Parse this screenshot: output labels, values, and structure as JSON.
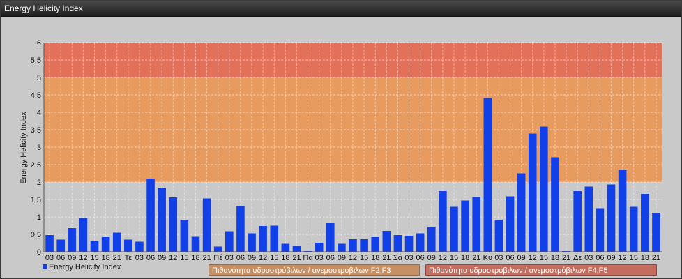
{
  "window": {
    "title": "Energy Helicity Index"
  },
  "legend": {
    "series_label": "Energy Helicity Index"
  },
  "bands": [
    {
      "label": "Πιθανότητα υδροστρόβιλων / ανεμοστρόβιλων F2,F3",
      "range": [
        2,
        5
      ],
      "color": "#e89b5e"
    },
    {
      "label": "Πιθανότητα υδροστρόβιλων / ανεμοστρόβιλων F4,F5",
      "range": [
        5,
        6
      ],
      "color": "#e37058"
    }
  ],
  "chart_data": {
    "type": "bar",
    "title": "",
    "xlabel": "",
    "ylabel": "Energy Helicity Index",
    "ylim": [
      0,
      6
    ],
    "yticks": [
      "0",
      "0.5",
      "1",
      "1.5",
      "2",
      "2.5",
      "3",
      "3.5",
      "4",
      "4.5",
      "5",
      "5.5",
      "6"
    ],
    "grid": true,
    "legend_position": "bottom-left",
    "categories": [
      "03",
      "06",
      "09",
      "12",
      "15",
      "18",
      "21",
      "Τε",
      "03",
      "06",
      "09",
      "12",
      "15",
      "18",
      "21",
      "Πέ",
      "03",
      "06",
      "09",
      "12",
      "15",
      "18",
      "21",
      "Πα",
      "03",
      "06",
      "09",
      "12",
      "15",
      "18",
      "21",
      "Σά",
      "03",
      "06",
      "09",
      "12",
      "15",
      "18",
      "21",
      "Κυ",
      "03",
      "06",
      "09",
      "12",
      "15",
      "18",
      "21",
      "Δε",
      "03",
      "06",
      "09",
      "12",
      "15",
      "18",
      "21"
    ],
    "series": [
      {
        "name": "Energy Helicity Index",
        "color": "#1140e8",
        "values": [
          0.48,
          0.35,
          0.68,
          0.97,
          0.3,
          0.42,
          0.55,
          0.35,
          0.29,
          2.1,
          1.82,
          1.56,
          0.92,
          0.43,
          1.53,
          0.15,
          0.59,
          1.32,
          0.53,
          0.74,
          0.75,
          0.23,
          0.17,
          0.02,
          0.26,
          0.82,
          0.23,
          0.36,
          0.36,
          0.42,
          0.6,
          0.48,
          0.46,
          0.53,
          0.72,
          1.74,
          1.29,
          1.47,
          1.57,
          4.41,
          0.92,
          1.59,
          2.25,
          3.39,
          3.59,
          2.71,
          0.02,
          1.74,
          1.87,
          1.25,
          1.93,
          2.34,
          1.29,
          1.66,
          1.12
        ]
      }
    ]
  }
}
